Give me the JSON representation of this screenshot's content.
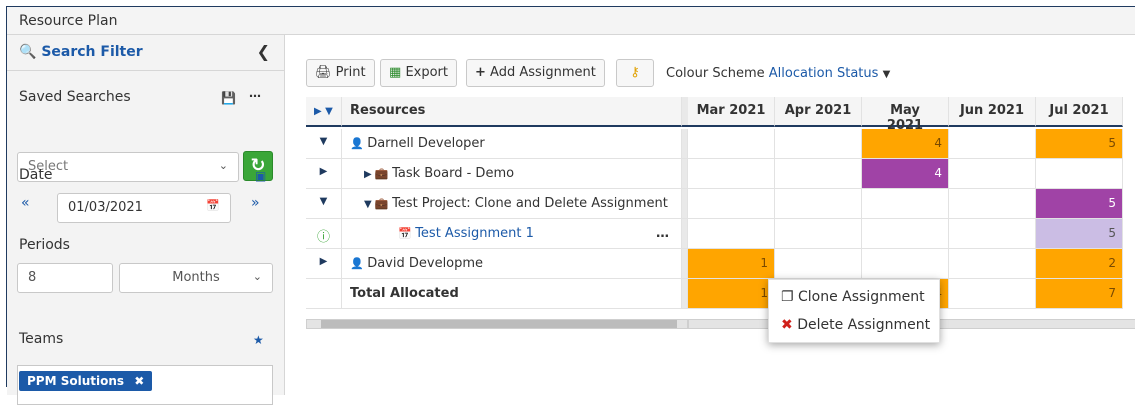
{
  "window": {
    "title": "Resource Plan"
  },
  "sidebar": {
    "header": "Search Filter",
    "saved_searches_label": "Saved Searches",
    "saved_select_placeholder": "Select",
    "date_label": "Date",
    "date_value": "01/03/2021",
    "periods_label": "Periods",
    "periods_value": "8",
    "periods_unit": "Months",
    "teams_label": "Teams",
    "team_tag": "PPM Solutions"
  },
  "toolbar": {
    "print_label": "Print",
    "export_label": "Export",
    "add_label": "Add Assignment",
    "scheme_label": "Colour Scheme",
    "scheme_value": "Allocation Status"
  },
  "grid": {
    "resources_header": "Resources",
    "months": [
      "Mar 2021",
      "Apr 2021",
      "May 2021",
      "Jun 2021",
      "Jul 2021"
    ],
    "rows": [
      {
        "label": "Darnell Developer",
        "values": [
          "",
          "",
          "4",
          "",
          "5"
        ]
      },
      {
        "label": "Task Board - Demo",
        "values": [
          "",
          "",
          "4",
          "",
          ""
        ]
      },
      {
        "label": "Test Project: Clone and Delete Assignment",
        "values": [
          "",
          "",
          "",
          "",
          "5"
        ]
      },
      {
        "label": "Test Assignment 1",
        "values": [
          "",
          "",
          "",
          "",
          "5"
        ]
      },
      {
        "label": "David Developme",
        "values": [
          "1",
          "",
          "",
          "",
          "2"
        ]
      },
      {
        "label": "Total Allocated",
        "values": [
          "1",
          "",
          "4",
          "",
          "7"
        ]
      }
    ]
  },
  "context_menu": {
    "clone_label": "Clone Assignment",
    "delete_label": "Delete Assignment"
  },
  "colors": {
    "orange": "#ffa500",
    "purple": "#a043a6",
    "lilac": "#cbbde4",
    "accent": "#1c5aa8"
  }
}
